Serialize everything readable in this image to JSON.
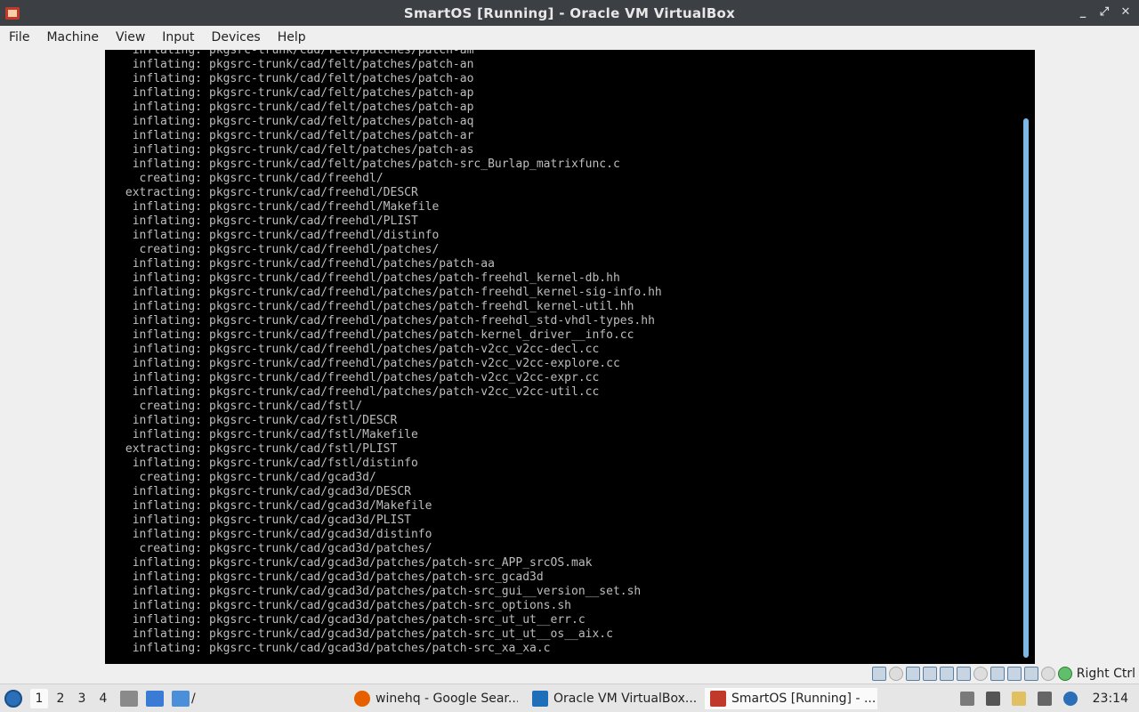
{
  "window": {
    "title": "SmartOS [Running] - Oracle VM VirtualBox",
    "controls": [
      "_",
      "⤢",
      "✕"
    ]
  },
  "menu": [
    "File",
    "Machine",
    "View",
    "Input",
    "Devices",
    "Help"
  ],
  "console": {
    "lines": [
      [
        "inflating:",
        "pkgsrc-trunk/cad/felt/patches/patch-am"
      ],
      [
        "inflating:",
        "pkgsrc-trunk/cad/felt/patches/patch-an"
      ],
      [
        "inflating:",
        "pkgsrc-trunk/cad/felt/patches/patch-ao"
      ],
      [
        "inflating:",
        "pkgsrc-trunk/cad/felt/patches/patch-ap"
      ],
      [
        "inflating:",
        "pkgsrc-trunk/cad/felt/patches/patch-ap"
      ],
      [
        "inflating:",
        "pkgsrc-trunk/cad/felt/patches/patch-aq"
      ],
      [
        "inflating:",
        "pkgsrc-trunk/cad/felt/patches/patch-ar"
      ],
      [
        "inflating:",
        "pkgsrc-trunk/cad/felt/patches/patch-as"
      ],
      [
        "inflating:",
        "pkgsrc-trunk/cad/felt/patches/patch-src_Burlap_matrixfunc.c"
      ],
      [
        "creating:",
        "pkgsrc-trunk/cad/freehdl/"
      ],
      [
        "extracting:",
        "pkgsrc-trunk/cad/freehdl/DESCR"
      ],
      [
        "inflating:",
        "pkgsrc-trunk/cad/freehdl/Makefile"
      ],
      [
        "inflating:",
        "pkgsrc-trunk/cad/freehdl/PLIST"
      ],
      [
        "inflating:",
        "pkgsrc-trunk/cad/freehdl/distinfo"
      ],
      [
        "creating:",
        "pkgsrc-trunk/cad/freehdl/patches/"
      ],
      [
        "inflating:",
        "pkgsrc-trunk/cad/freehdl/patches/patch-aa"
      ],
      [
        "inflating:",
        "pkgsrc-trunk/cad/freehdl/patches/patch-freehdl_kernel-db.hh"
      ],
      [
        "inflating:",
        "pkgsrc-trunk/cad/freehdl/patches/patch-freehdl_kernel-sig-info.hh"
      ],
      [
        "inflating:",
        "pkgsrc-trunk/cad/freehdl/patches/patch-freehdl_kernel-util.hh"
      ],
      [
        "inflating:",
        "pkgsrc-trunk/cad/freehdl/patches/patch-freehdl_std-vhdl-types.hh"
      ],
      [
        "inflating:",
        "pkgsrc-trunk/cad/freehdl/patches/patch-kernel_driver__info.cc"
      ],
      [
        "inflating:",
        "pkgsrc-trunk/cad/freehdl/patches/patch-v2cc_v2cc-decl.cc"
      ],
      [
        "inflating:",
        "pkgsrc-trunk/cad/freehdl/patches/patch-v2cc_v2cc-explore.cc"
      ],
      [
        "inflating:",
        "pkgsrc-trunk/cad/freehdl/patches/patch-v2cc_v2cc-expr.cc"
      ],
      [
        "inflating:",
        "pkgsrc-trunk/cad/freehdl/patches/patch-v2cc_v2cc-util.cc"
      ],
      [
        "creating:",
        "pkgsrc-trunk/cad/fstl/"
      ],
      [
        "inflating:",
        "pkgsrc-trunk/cad/fstl/DESCR"
      ],
      [
        "inflating:",
        "pkgsrc-trunk/cad/fstl/Makefile"
      ],
      [
        "extracting:",
        "pkgsrc-trunk/cad/fstl/PLIST"
      ],
      [
        "inflating:",
        "pkgsrc-trunk/cad/fstl/distinfo"
      ],
      [
        "creating:",
        "pkgsrc-trunk/cad/gcad3d/"
      ],
      [
        "inflating:",
        "pkgsrc-trunk/cad/gcad3d/DESCR"
      ],
      [
        "inflating:",
        "pkgsrc-trunk/cad/gcad3d/Makefile"
      ],
      [
        "inflating:",
        "pkgsrc-trunk/cad/gcad3d/PLIST"
      ],
      [
        "inflating:",
        "pkgsrc-trunk/cad/gcad3d/distinfo"
      ],
      [
        "creating:",
        "pkgsrc-trunk/cad/gcad3d/patches/"
      ],
      [
        "inflating:",
        "pkgsrc-trunk/cad/gcad3d/patches/patch-src_APP_srcOS.mak"
      ],
      [
        "inflating:",
        "pkgsrc-trunk/cad/gcad3d/patches/patch-src_gcad3d"
      ],
      [
        "inflating:",
        "pkgsrc-trunk/cad/gcad3d/patches/patch-src_gui__version__set.sh"
      ],
      [
        "inflating:",
        "pkgsrc-trunk/cad/gcad3d/patches/patch-src_options.sh"
      ],
      [
        "inflating:",
        "pkgsrc-trunk/cad/gcad3d/patches/patch-src_ut_ut__err.c"
      ],
      [
        "inflating:",
        "pkgsrc-trunk/cad/gcad3d/patches/patch-src_ut_ut__os__aix.c"
      ],
      [
        "inflating:",
        "pkgsrc-trunk/cad/gcad3d/patches/patch-src_xa_xa.c"
      ]
    ]
  },
  "statusbar": {
    "icons": [
      "hard-disk-icon",
      "optical-drive-icon",
      "audio-icon",
      "network-icon",
      "usb-icon",
      "shared-folders-icon",
      "display-icon",
      "video-capture-icon",
      "recording-icon",
      "cpu-icon",
      "mouse-integration-icon",
      "keyboard-icon"
    ],
    "host_key": "Right Ctrl"
  },
  "taskbar": {
    "workspaces": [
      "1",
      "2",
      "3",
      "4"
    ],
    "launcher_suffix": "/",
    "tasks": [
      {
        "label": "winehq - Google Sear...",
        "icon": "firefox-icon"
      },
      {
        "label": "Oracle VM VirtualBox...",
        "icon": "virtualbox-manager-icon"
      },
      {
        "label": "SmartOS [Running] - ...",
        "icon": "virtualbox-vm-icon"
      }
    ],
    "clock": "23:14"
  },
  "colors": {
    "titlebar": "#3c3f43",
    "console_bg": "#000000",
    "console_fg": "#bdbdbd",
    "scrollbar": "#7fb7e4"
  }
}
